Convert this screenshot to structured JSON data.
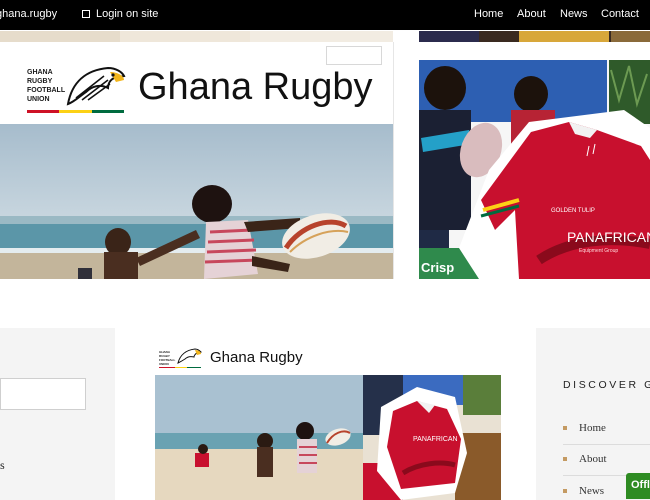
{
  "topbar": {
    "site_name": "ghana.rugby",
    "login_label": "Login on site",
    "nav": [
      {
        "label": "Home"
      },
      {
        "label": "About"
      },
      {
        "label": "News"
      },
      {
        "label": "Contact"
      }
    ]
  },
  "hero": {
    "logo_lines": [
      "GHANA",
      "RUGBY",
      "FOOTBALL",
      "UNION"
    ],
    "title": "Ghana Rugby",
    "jersey_brand": "PANAFRICAN",
    "jersey_sub": "Equipment Group",
    "jersey_label": "GOLDEN TULIP",
    "sign_text": "Crisp"
  },
  "card": {
    "title": "Ghana Rugby",
    "logo_lines": [
      "GHANA",
      "RUGBY",
      "FOOTBALL",
      "UNION"
    ],
    "jersey_brand": "PANAFRICAN"
  },
  "left_panel": {
    "trailing_text": "s"
  },
  "sidebar": {
    "heading": "DISCOVER GH",
    "items": [
      {
        "label": "Home"
      },
      {
        "label": "About"
      },
      {
        "label": "News"
      }
    ]
  },
  "chat": {
    "label": "Offl"
  },
  "colors": {
    "topbar": "#000000",
    "flag_red": "#ce1126",
    "flag_gold": "#fcd116",
    "flag_green": "#006b3f",
    "jersey_red": "#c8102e",
    "accent_gold": "#c49a62",
    "chat_green": "#2e8b22"
  }
}
